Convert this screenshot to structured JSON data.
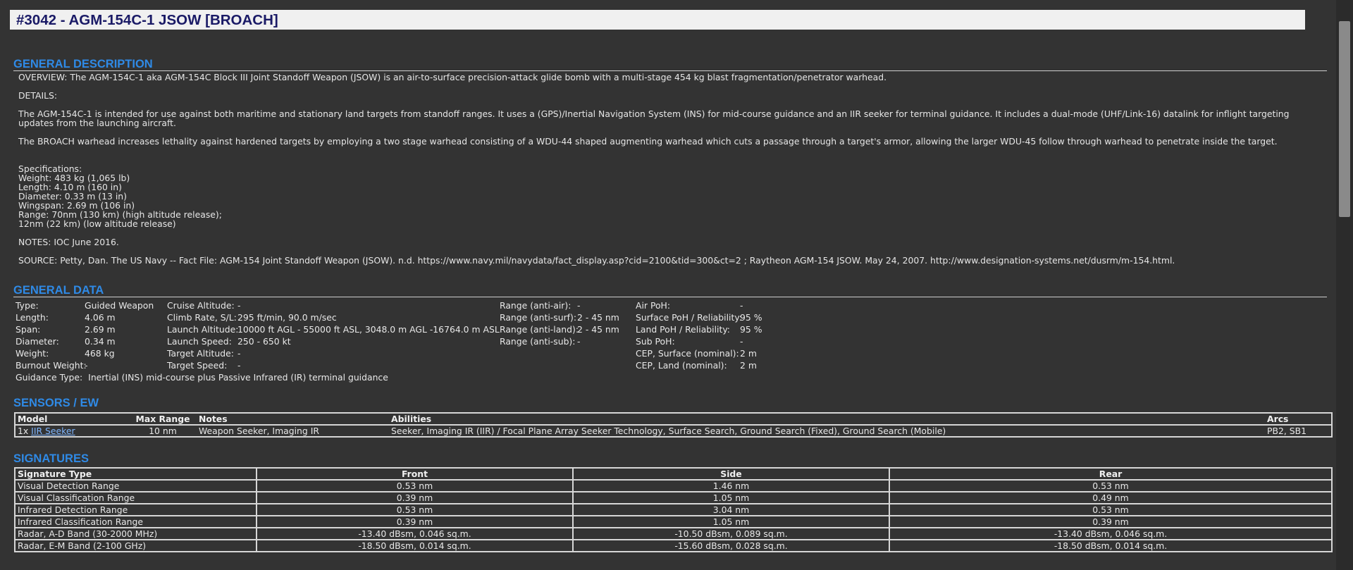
{
  "title": "#3042 - AGM-154C-1 JSOW [BROACH]",
  "sections": {
    "general_description": "GENERAL DESCRIPTION",
    "general_data": "GENERAL DATA",
    "sensors": "SENSORS / EW",
    "signatures": "SIGNATURES"
  },
  "description": {
    "overview": "OVERVIEW: The AGM-154C-1 aka AGM-154C Block III Joint Standoff Weapon (JSOW) is an air-to-surface precision-attack glide bomb with a multi-stage 454 kg blast fragmentation/penetrator warhead.",
    "details_label": "DETAILS:",
    "details_1": "The AGM-154C-1 is intended for use against both maritime and stationary land targets from standoff ranges. It uses a (GPS)/Inertial Navigation System (INS) for mid-course guidance and an IIR seeker for terminal guidance. It includes a dual-mode (UHF/Link-16) datalink for inflight targeting updates from the launching aircraft.",
    "details_2": "The BROACH warhead increases lethality against hardened targets by employing a two stage warhead consisting of a WDU-44 shaped augmenting warhead which cuts a passage through a target's armor, allowing the larger WDU-45 follow through warhead to penetrate inside the target.",
    "spec_lines": [
      "Specifications:",
      "Weight: 483 kg (1,065 lb)",
      "Length: 4.10 m (160 in)",
      "Diameter: 0.33 m (13 in)",
      "Wingspan: 2.69 m (106 in)",
      "Range: 70nm (130 km) (high altitude release);",
      "12nm (22 km) (low altitude release)"
    ],
    "notes": "NOTES: IOC June 2016.",
    "source": "SOURCE: Petty, Dan. The US Navy -- Fact File: AGM-154 Joint Standoff Weapon (JSOW). n.d. https://www.navy.mil/navydata/fact_display.asp?cid=2100&tid=300&ct=2 ; Raytheon AGM-154 JSOW. May 24, 2007. http://www.designation-systems.net/dusrm/m-154.html."
  },
  "general_data": {
    "col1": [
      {
        "label": "Type:",
        "value": "Guided Weapon"
      },
      {
        "label": "Length:",
        "value": "4.06 m"
      },
      {
        "label": "Span:",
        "value": "2.69 m"
      },
      {
        "label": "Diameter:",
        "value": "0.34 m"
      },
      {
        "label": "Weight:",
        "value": "468 kg"
      },
      {
        "label": "Burnout Weight:",
        "value": "-"
      }
    ],
    "col2": [
      {
        "label": "Cruise Altitude:",
        "value": "-"
      },
      {
        "label": "Climb Rate, S/L:",
        "value": "295 ft/min, 90.0 m/sec"
      },
      {
        "label": "Launch Altitude:",
        "value": "10000 ft AGL - 55000 ft ASL, 3048.0 m AGL -16764.0 m ASL"
      },
      {
        "label": "Launch Speed:",
        "value": "250 - 650 kt"
      },
      {
        "label": "Target Altitude:",
        "value": "-"
      },
      {
        "label": "Target Speed:",
        "value": "-"
      }
    ],
    "col3": [
      {
        "label": "Range (anti-air):",
        "value": "-"
      },
      {
        "label": "Range (anti-surf):",
        "value": "2 - 45 nm"
      },
      {
        "label": "Range (anti-land):",
        "value": "2 - 45 nm"
      },
      {
        "label": "Range (anti-sub):",
        "value": "-"
      }
    ],
    "col4": [
      {
        "label": "Air PoH:",
        "value": "-"
      },
      {
        "label": "Surface PoH / Reliability:",
        "value": "95 %"
      },
      {
        "label": "Land PoH / Reliability:",
        "value": "95 %"
      },
      {
        "label": "Sub PoH:",
        "value": "-"
      },
      {
        "label": "CEP, Surface (nominal):",
        "value": "2 m"
      },
      {
        "label": "CEP, Land (nominal):",
        "value": "2 m"
      }
    ],
    "guidance_label": "Guidance Type:",
    "guidance_value": "Inertial (INS) mid-course plus Passive Infrared (IR) terminal guidance"
  },
  "sensors": {
    "headers": [
      "Model",
      "Max Range",
      "Notes",
      "Abilities",
      "Arcs"
    ],
    "rows": [
      {
        "qty": "1x",
        "model": "IIR Seeker",
        "max_range": "10 nm",
        "notes": "Weapon Seeker, Imaging IR",
        "abilities": "Seeker, Imaging IR (IIR) / Focal Plane Array Seeker Technology, Surface Search, Ground Search (Fixed), Ground Search (Mobile)",
        "arcs": "PB2, SB1"
      }
    ]
  },
  "signatures": {
    "headers": [
      "Signature Type",
      "Front",
      "Side",
      "Rear"
    ],
    "rows": [
      [
        "Visual Detection Range",
        "0.53 nm",
        "1.46 nm",
        "0.53 nm"
      ],
      [
        "Visual Classification Range",
        "0.39 nm",
        "1.05 nm",
        "0.49 nm"
      ],
      [
        "Infrared Detection Range",
        "0.53 nm",
        "3.04 nm",
        "0.53 nm"
      ],
      [
        "Infrared Classification Range",
        "0.39 nm",
        "1.05 nm",
        "0.39 nm"
      ],
      [
        "Radar, A-D Band (30-2000 MHz)",
        "-13.40 dBsm, 0.046 sq.m.",
        "-10.50 dBsm, 0.089 sq.m.",
        "-13.40 dBsm, 0.046 sq.m."
      ],
      [
        "Radar, E-M Band (2-100 GHz)",
        "-18.50 dBsm, 0.014 sq.m.",
        "-15.60 dBsm, 0.028 sq.m.",
        "-18.50 dBsm, 0.014 sq.m."
      ]
    ]
  },
  "colors": {
    "background": "#333333",
    "section_heading": "#2f8ae6",
    "title_text": "#1a1a66",
    "title_bar": "#f0f0f0",
    "link": "#7fb6ff"
  }
}
